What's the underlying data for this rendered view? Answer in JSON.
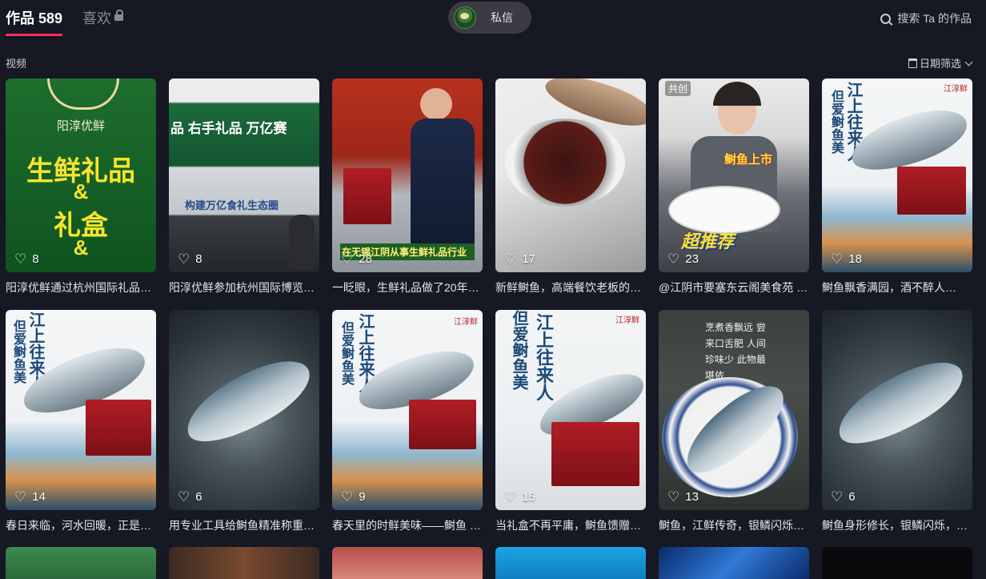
{
  "tabs": {
    "works_label": "作品 589",
    "likes_label": "喜欢"
  },
  "dm": {
    "label": "私信"
  },
  "search": {
    "label": "搜索 Ta 的作品"
  },
  "section": {
    "title": "视频"
  },
  "filter": {
    "label": "日期筛选"
  },
  "videos": [
    {
      "likes": "8",
      "title": "阳淳优鲜通过杭州国际礼品…"
    },
    {
      "likes": "8",
      "title": "阳淳优鲜参加杭州国际博览…"
    },
    {
      "likes": "28",
      "title": "一眨眼，生鲜礼品做了20年…"
    },
    {
      "likes": "17",
      "title": "新鲜鲥鱼，高端餐饮老板的…"
    },
    {
      "likes": "23",
      "title": "@江阴市要塞东云阁美食苑 …",
      "badge": "共创"
    },
    {
      "likes": "18",
      "title": "鲥鱼飘香满园，酒不醉人…"
    },
    {
      "likes": "14",
      "title": "春日来临，河水回暖，正是…"
    },
    {
      "likes": "6",
      "title": "用专业工具给鲥鱼精准称重…"
    },
    {
      "likes": "9",
      "title": "春天里的时鲜美味——鲥鱼 …"
    },
    {
      "likes": "15",
      "title": "当礼盒不再平庸，鲥鱼馈赠…"
    },
    {
      "likes": "13",
      "title": "鲥鱼，江鲜传奇，银鳞闪烁…"
    },
    {
      "likes": "6",
      "title": "鲥鱼身形修长，银鳞闪烁，…"
    }
  ],
  "thumb_text": {
    "brand": "阳淳优鲜",
    "gift_line1": "生鲜礼品",
    "amp": "&",
    "gift_line2": "礼盒",
    "expo_banner": "品 右手礼品 万亿赛",
    "expo_sub": "构建万亿食礼生态圈",
    "wuxi_caption": "在无锡江阴从事生鲜礼品行业",
    "market": "鲥鱼上市",
    "recommend": "超推荐",
    "poem1": "江上往来人",
    "poem2": "但爱鲥鱼美",
    "dish_poem": "烹煮香飘远 尝来口舌肥 人间珍味少 此物最堪依",
    "brand2": "江淳鲜"
  }
}
